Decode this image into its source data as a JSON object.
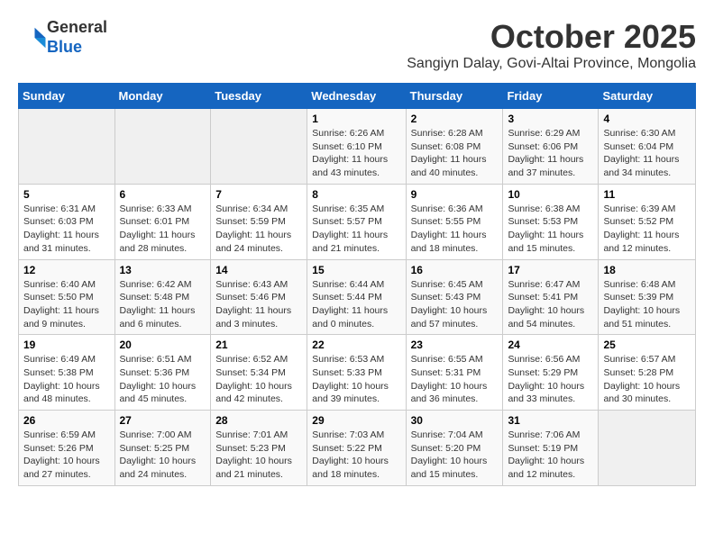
{
  "header": {
    "logo_line1": "General",
    "logo_line2": "Blue",
    "month_title": "October 2025",
    "location": "Sangiyn Dalay, Govi-Altai Province, Mongolia"
  },
  "days_of_week": [
    "Sunday",
    "Monday",
    "Tuesday",
    "Wednesday",
    "Thursday",
    "Friday",
    "Saturday"
  ],
  "weeks": [
    [
      {
        "day": "",
        "info": ""
      },
      {
        "day": "",
        "info": ""
      },
      {
        "day": "",
        "info": ""
      },
      {
        "day": "1",
        "info": "Sunrise: 6:26 AM\nSunset: 6:10 PM\nDaylight: 11 hours\nand 43 minutes."
      },
      {
        "day": "2",
        "info": "Sunrise: 6:28 AM\nSunset: 6:08 PM\nDaylight: 11 hours\nand 40 minutes."
      },
      {
        "day": "3",
        "info": "Sunrise: 6:29 AM\nSunset: 6:06 PM\nDaylight: 11 hours\nand 37 minutes."
      },
      {
        "day": "4",
        "info": "Sunrise: 6:30 AM\nSunset: 6:04 PM\nDaylight: 11 hours\nand 34 minutes."
      }
    ],
    [
      {
        "day": "5",
        "info": "Sunrise: 6:31 AM\nSunset: 6:03 PM\nDaylight: 11 hours\nand 31 minutes."
      },
      {
        "day": "6",
        "info": "Sunrise: 6:33 AM\nSunset: 6:01 PM\nDaylight: 11 hours\nand 28 minutes."
      },
      {
        "day": "7",
        "info": "Sunrise: 6:34 AM\nSunset: 5:59 PM\nDaylight: 11 hours\nand 24 minutes."
      },
      {
        "day": "8",
        "info": "Sunrise: 6:35 AM\nSunset: 5:57 PM\nDaylight: 11 hours\nand 21 minutes."
      },
      {
        "day": "9",
        "info": "Sunrise: 6:36 AM\nSunset: 5:55 PM\nDaylight: 11 hours\nand 18 minutes."
      },
      {
        "day": "10",
        "info": "Sunrise: 6:38 AM\nSunset: 5:53 PM\nDaylight: 11 hours\nand 15 minutes."
      },
      {
        "day": "11",
        "info": "Sunrise: 6:39 AM\nSunset: 5:52 PM\nDaylight: 11 hours\nand 12 minutes."
      }
    ],
    [
      {
        "day": "12",
        "info": "Sunrise: 6:40 AM\nSunset: 5:50 PM\nDaylight: 11 hours\nand 9 minutes."
      },
      {
        "day": "13",
        "info": "Sunrise: 6:42 AM\nSunset: 5:48 PM\nDaylight: 11 hours\nand 6 minutes."
      },
      {
        "day": "14",
        "info": "Sunrise: 6:43 AM\nSunset: 5:46 PM\nDaylight: 11 hours\nand 3 minutes."
      },
      {
        "day": "15",
        "info": "Sunrise: 6:44 AM\nSunset: 5:44 PM\nDaylight: 11 hours\nand 0 minutes."
      },
      {
        "day": "16",
        "info": "Sunrise: 6:45 AM\nSunset: 5:43 PM\nDaylight: 10 hours\nand 57 minutes."
      },
      {
        "day": "17",
        "info": "Sunrise: 6:47 AM\nSunset: 5:41 PM\nDaylight: 10 hours\nand 54 minutes."
      },
      {
        "day": "18",
        "info": "Sunrise: 6:48 AM\nSunset: 5:39 PM\nDaylight: 10 hours\nand 51 minutes."
      }
    ],
    [
      {
        "day": "19",
        "info": "Sunrise: 6:49 AM\nSunset: 5:38 PM\nDaylight: 10 hours\nand 48 minutes."
      },
      {
        "day": "20",
        "info": "Sunrise: 6:51 AM\nSunset: 5:36 PM\nDaylight: 10 hours\nand 45 minutes."
      },
      {
        "day": "21",
        "info": "Sunrise: 6:52 AM\nSunset: 5:34 PM\nDaylight: 10 hours\nand 42 minutes."
      },
      {
        "day": "22",
        "info": "Sunrise: 6:53 AM\nSunset: 5:33 PM\nDaylight: 10 hours\nand 39 minutes."
      },
      {
        "day": "23",
        "info": "Sunrise: 6:55 AM\nSunset: 5:31 PM\nDaylight: 10 hours\nand 36 minutes."
      },
      {
        "day": "24",
        "info": "Sunrise: 6:56 AM\nSunset: 5:29 PM\nDaylight: 10 hours\nand 33 minutes."
      },
      {
        "day": "25",
        "info": "Sunrise: 6:57 AM\nSunset: 5:28 PM\nDaylight: 10 hours\nand 30 minutes."
      }
    ],
    [
      {
        "day": "26",
        "info": "Sunrise: 6:59 AM\nSunset: 5:26 PM\nDaylight: 10 hours\nand 27 minutes."
      },
      {
        "day": "27",
        "info": "Sunrise: 7:00 AM\nSunset: 5:25 PM\nDaylight: 10 hours\nand 24 minutes."
      },
      {
        "day": "28",
        "info": "Sunrise: 7:01 AM\nSunset: 5:23 PM\nDaylight: 10 hours\nand 21 minutes."
      },
      {
        "day": "29",
        "info": "Sunrise: 7:03 AM\nSunset: 5:22 PM\nDaylight: 10 hours\nand 18 minutes."
      },
      {
        "day": "30",
        "info": "Sunrise: 7:04 AM\nSunset: 5:20 PM\nDaylight: 10 hours\nand 15 minutes."
      },
      {
        "day": "31",
        "info": "Sunrise: 7:06 AM\nSunset: 5:19 PM\nDaylight: 10 hours\nand 12 minutes."
      },
      {
        "day": "",
        "info": ""
      }
    ]
  ]
}
